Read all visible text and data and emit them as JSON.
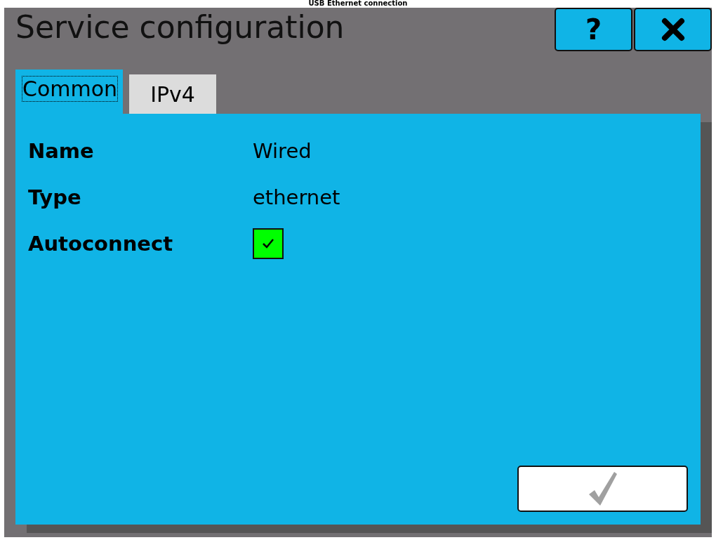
{
  "top_caption": "USB Ethernet connection",
  "window": {
    "title": "Service configuration",
    "help_button": "?"
  },
  "tabs": [
    {
      "label": "Common",
      "selected": true
    },
    {
      "label": "IPv4",
      "selected": false
    }
  ],
  "fields": [
    {
      "label": "Name",
      "kind": "text",
      "value": "Wired"
    },
    {
      "label": "Type",
      "kind": "text",
      "value": "ethernet"
    },
    {
      "label": "Autoconnect",
      "kind": "checkbox",
      "checked": true
    }
  ]
}
